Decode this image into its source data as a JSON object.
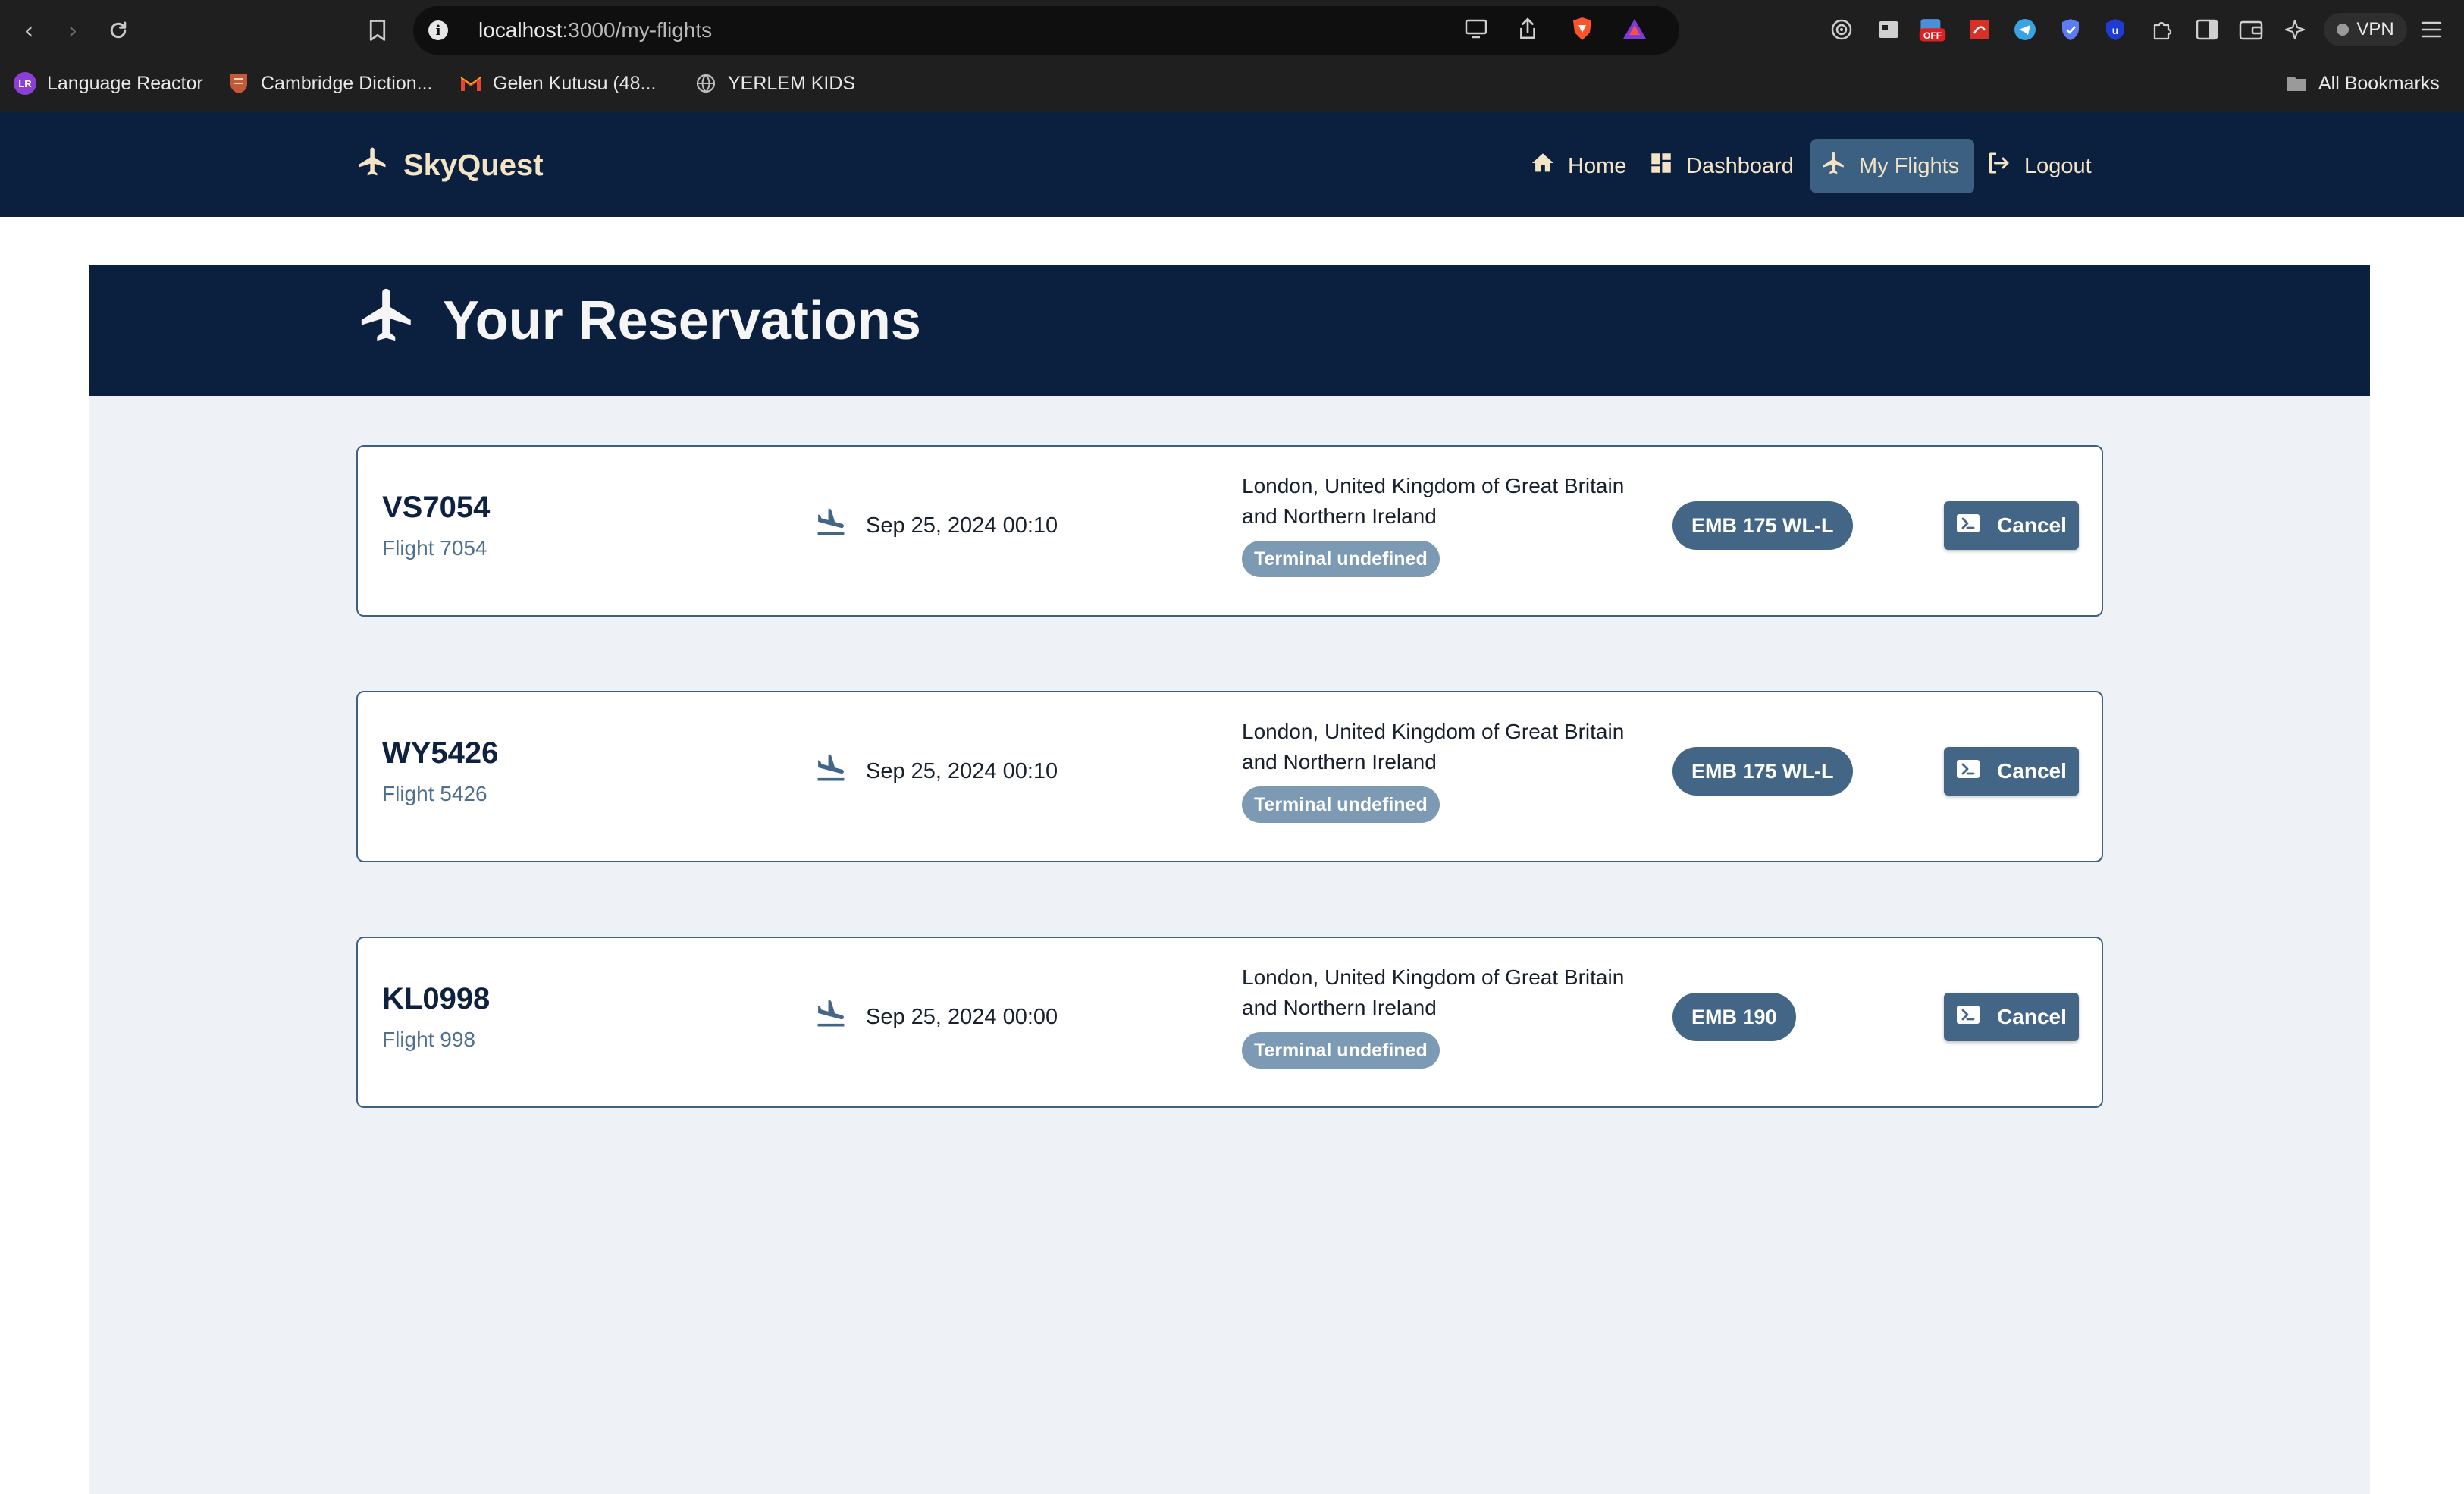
{
  "browser": {
    "url_host": "localhost",
    "url_path": ":3000/my-flights",
    "vpn_label": "VPN",
    "bookmarks": [
      {
        "label": "Language Reactor"
      },
      {
        "label": "Cambridge Diction..."
      },
      {
        "label": "Gelen Kutusu (48..."
      },
      {
        "label": "YERLEM KIDS"
      }
    ],
    "all_bookmarks": "All Bookmarks"
  },
  "app": {
    "brand": "SkyQuest",
    "nav": [
      {
        "label": "Home",
        "icon": "home-icon"
      },
      {
        "label": "Dashboard",
        "icon": "dashboard-icon"
      },
      {
        "label": "My Flights",
        "icon": "plane-icon",
        "active": true
      },
      {
        "label": "Logout",
        "icon": "logout-icon"
      }
    ]
  },
  "page": {
    "title": "Your Reservations",
    "reservations": [
      {
        "code": "VS7054",
        "flight_label": "Flight 7054",
        "datetime": "Sep 25, 2024 00:10",
        "location": "London, United Kingdom of Great Britain and Northern Ireland",
        "terminal": "Terminal undefined",
        "aircraft": "EMB 175 WL-L",
        "cancel_label": "Cancel"
      },
      {
        "code": "WY5426",
        "flight_label": "Flight 5426",
        "datetime": "Sep 25, 2024 00:10",
        "location": "London, United Kingdom of Great Britain and Northern Ireland",
        "terminal": "Terminal undefined",
        "aircraft": "EMB 175 WL-L",
        "cancel_label": "Cancel"
      },
      {
        "code": "KL0998",
        "flight_label": "Flight 998",
        "datetime": "Sep 25, 2024 00:00",
        "location": "London, United Kingdom of Great Britain and Northern Ireland",
        "terminal": "Terminal undefined",
        "aircraft": "EMB 190",
        "cancel_label": "Cancel"
      }
    ]
  },
  "colors": {
    "navy": "#0b1f3f",
    "accent": "#436686",
    "cream": "#f3e4c6",
    "page_bg": "#eef2f6"
  }
}
